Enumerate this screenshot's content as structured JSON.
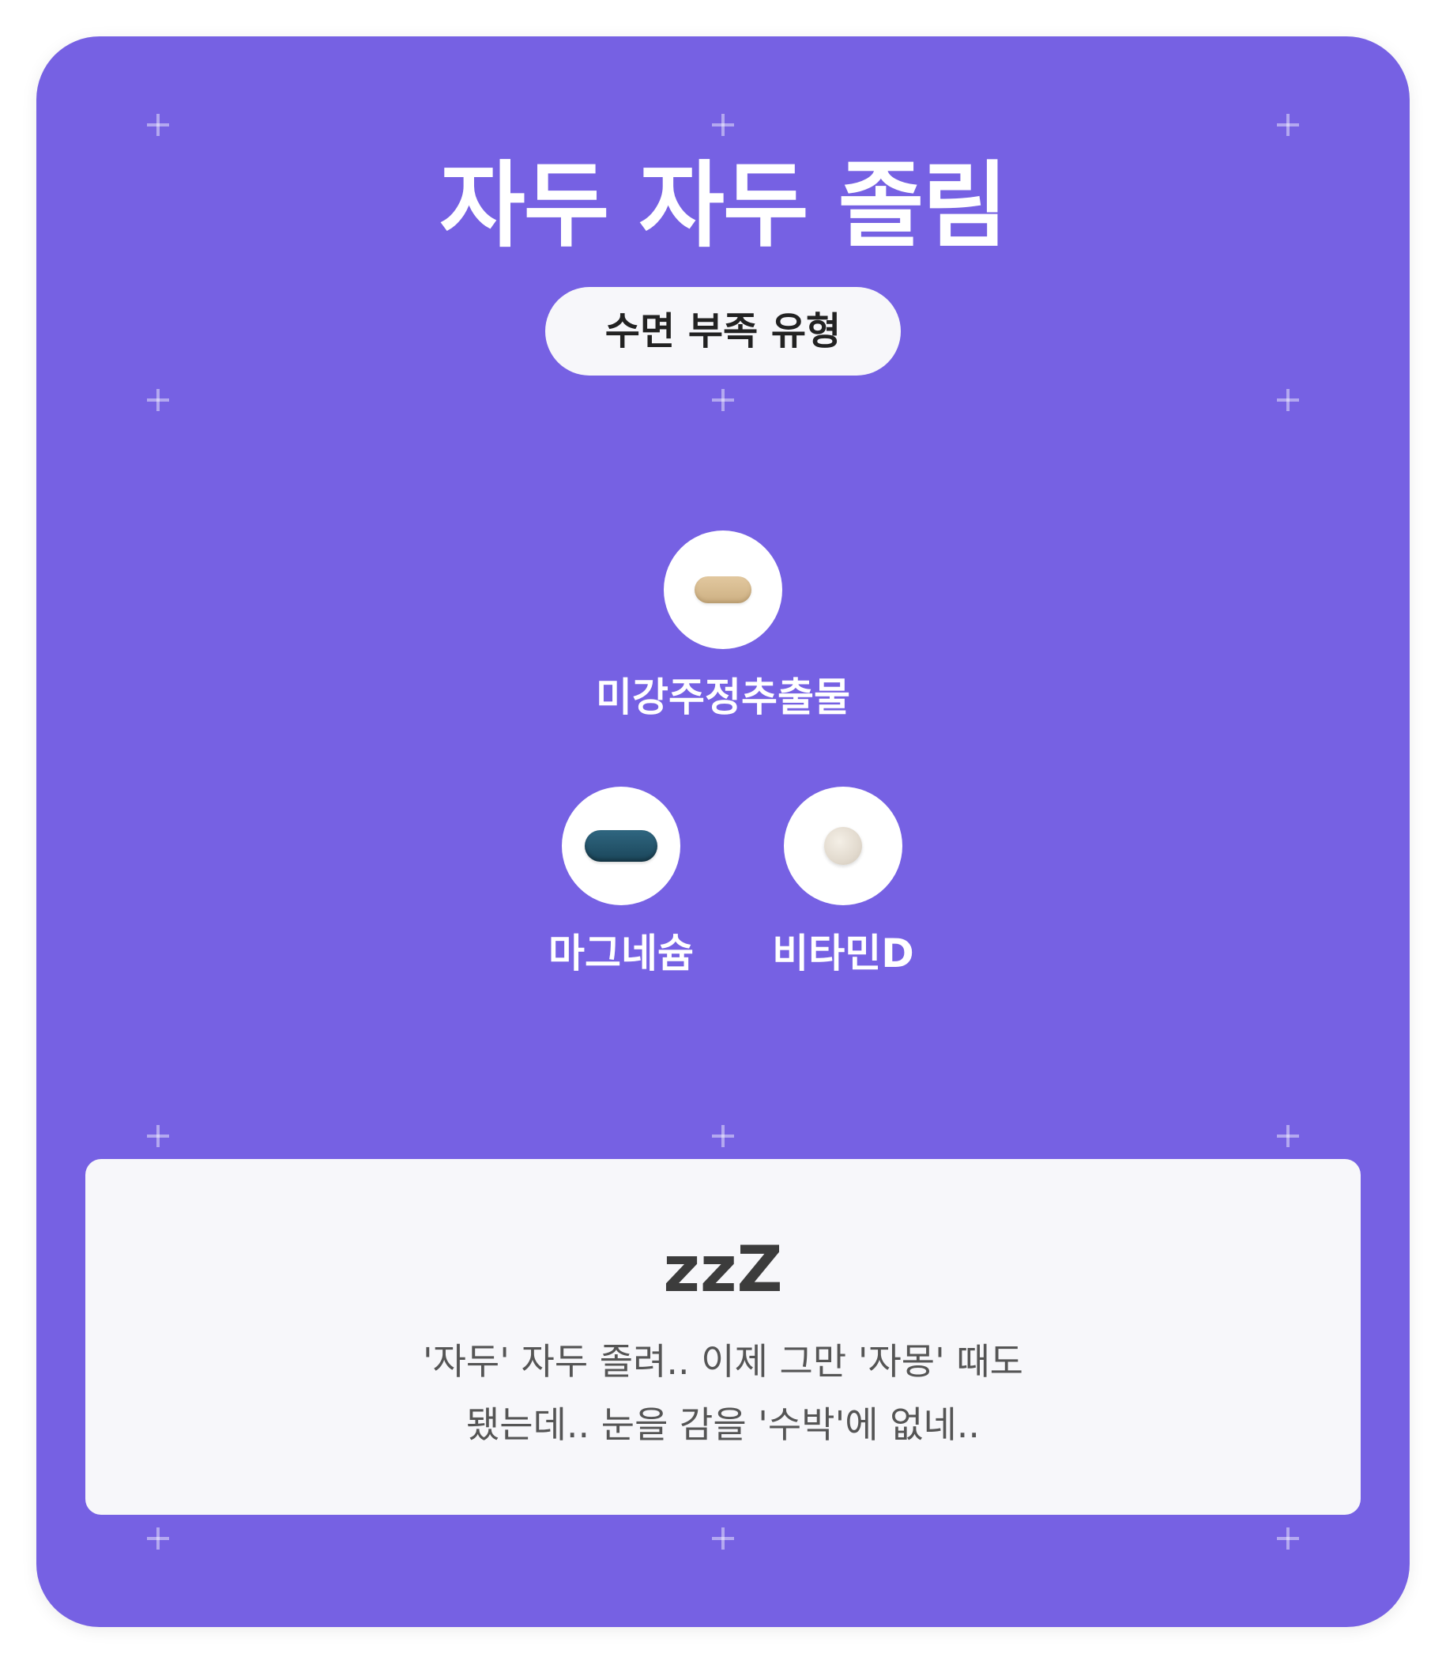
{
  "card": {
    "title": "자두 자두 졸림",
    "type_badge": "수면 부족 유형",
    "background_color": "#7661e3"
  },
  "supplements": [
    {
      "name": "미강주정추출물",
      "pill_icon": "beige-capsule-icon",
      "pill_color": "#d7bd92"
    },
    {
      "name": "마그네슘",
      "pill_icon": "blue-capsule-icon",
      "pill_color": "#245670"
    },
    {
      "name": "비타민D",
      "pill_icon": "round-tablet-icon",
      "pill_color": "#e7e0d5"
    }
  ],
  "comment": {
    "heading": "zzZ",
    "lines": [
      "'자두' 자두 졸려.. 이제 그만 '자몽' 때도",
      "됐는데.. 눈을 감을 '수박'에 없네.."
    ]
  },
  "decorations": {
    "plus_icon": "plus-icon"
  }
}
